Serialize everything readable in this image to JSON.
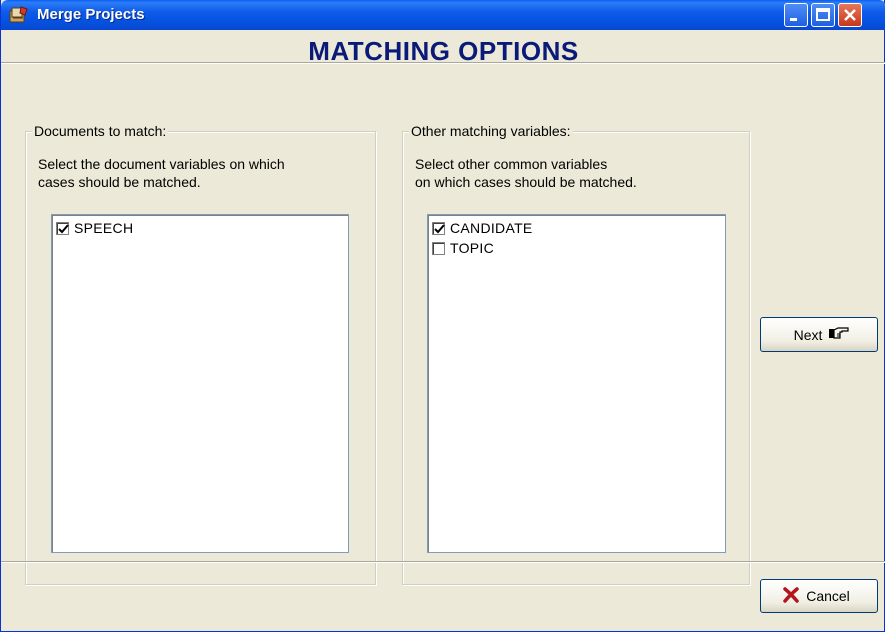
{
  "window": {
    "title": "Merge Projects",
    "app_icon": "merge-projects-icon"
  },
  "header": {
    "title": "MATCHING OPTIONS"
  },
  "documents_group": {
    "legend": "Documents to match:",
    "description_line1": "Select the document variables on which",
    "description_line2": "cases should be matched.",
    "items": [
      {
        "label": "SPEECH",
        "checked": true
      }
    ]
  },
  "variables_group": {
    "legend": "Other matching variables:",
    "description_line1": "Select other common variables",
    "description_line2": "on which cases should be matched.",
    "items": [
      {
        "label": "CANDIDATE",
        "checked": true
      },
      {
        "label": "TOPIC",
        "checked": false
      }
    ]
  },
  "buttons": {
    "next_label": "Next",
    "next_icon": "pointing-hand-icon",
    "cancel_label": "Cancel",
    "cancel_icon": "red-x-icon"
  },
  "colors": {
    "title_text": "#0a1a78",
    "titlebar": "#0553e1",
    "face": "#ece9d8",
    "cancel_icon": "#b0161b"
  }
}
